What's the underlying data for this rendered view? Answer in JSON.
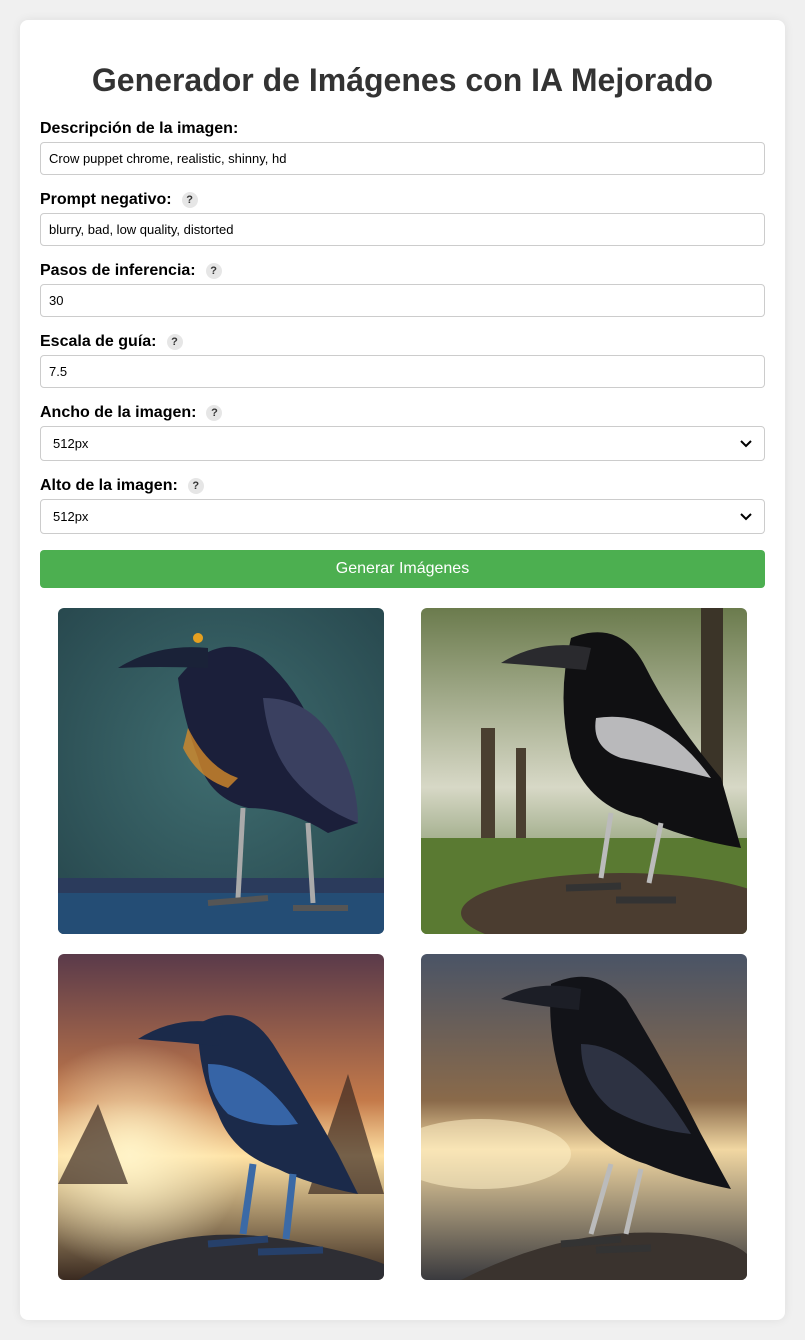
{
  "page": {
    "title": "Generador de Imágenes con IA Mejorado"
  },
  "form": {
    "description": {
      "label": "Descripción de la imagen:",
      "value": "Crow puppet chrome, realistic, shinny, hd"
    },
    "negative_prompt": {
      "label": "Prompt negativo:",
      "help": "?",
      "value": "blurry, bad, low quality, distorted"
    },
    "inference_steps": {
      "label": "Pasos de inferencia:",
      "help": "?",
      "value": "30"
    },
    "guidance_scale": {
      "label": "Escala de guía:",
      "help": "?",
      "value": "7.5"
    },
    "image_width": {
      "label": "Ancho de la imagen:",
      "help": "?",
      "selected": "512px"
    },
    "image_height": {
      "label": "Alto de la imagen:",
      "help": "?",
      "selected": "512px"
    },
    "generate_label": "Generar Imágenes"
  },
  "gallery": [
    {
      "subject": "robotic chrome crow on teal background"
    },
    {
      "subject": "robotic chrome crow in forest park"
    },
    {
      "subject": "robotic chrome crow at sunset"
    },
    {
      "subject": "robotic chrome crow on rock at dusk"
    }
  ],
  "colors": {
    "accent": "#4caf50",
    "page_bg": "#f0f0f0",
    "card_bg": "#ffffff"
  },
  "icons": {
    "help": "question-mark",
    "select_arrow": "chevron-down"
  }
}
